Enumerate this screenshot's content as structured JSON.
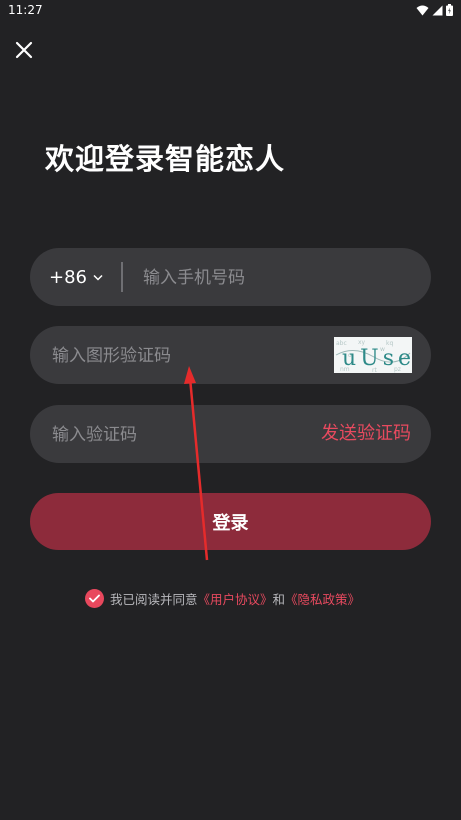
{
  "status_bar": {
    "time": "11:27"
  },
  "icons": {
    "close": "close-icon",
    "wifi": "wifi-icon",
    "signal": "signal-icon",
    "battery": "battery-icon",
    "dropdown": "chevron-down-icon",
    "check": "check-icon"
  },
  "title": "欢迎登录智能恋人",
  "phone": {
    "country_code": "+86",
    "placeholder": "输入手机号码"
  },
  "captcha": {
    "placeholder": "输入图形验证码",
    "image_text": "uUse"
  },
  "sms_code": {
    "placeholder": "输入验证码",
    "send_label": "发送验证码"
  },
  "login_button": "登录",
  "agreement": {
    "checked": true,
    "prefix": "我已阅读并同意",
    "user_agreement": "《用户协议》",
    "and": "和",
    "privacy_policy": "《隐私政策》"
  },
  "colors": {
    "background": "#222224",
    "field": "#3a3a3d",
    "accent": "#e84a5f",
    "button": "#8d2b3b"
  }
}
